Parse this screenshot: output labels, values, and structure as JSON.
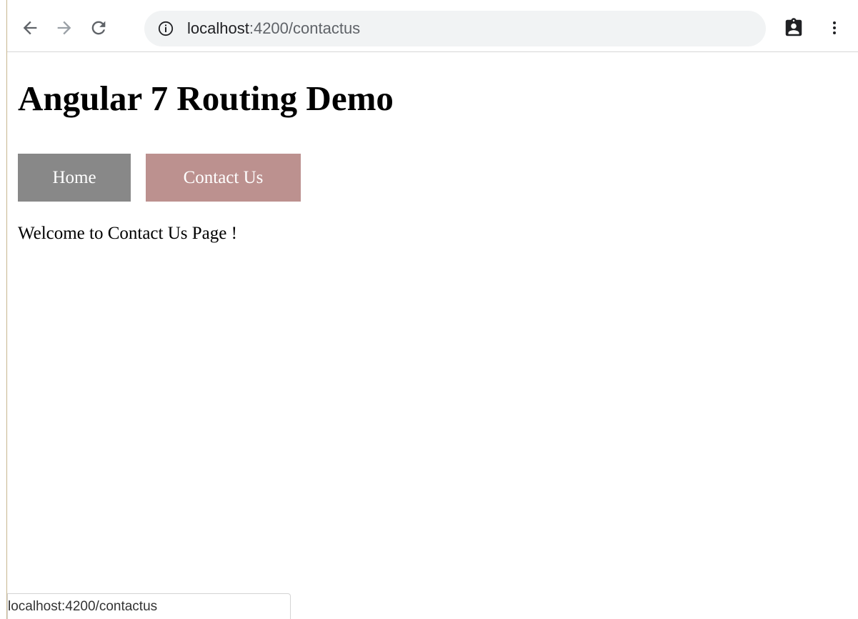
{
  "browser": {
    "url_host": "localhost",
    "url_rest": ":4200/contactus",
    "icons": {
      "back": "back-arrow-icon",
      "forward": "forward-arrow-icon",
      "reload": "reload-icon",
      "site_info": "info-icon",
      "clipboard": "clipboard-icon",
      "menu": "kebab-menu-icon"
    }
  },
  "page": {
    "title": "Angular 7 Routing Demo",
    "nav": [
      {
        "label": "Home",
        "color": "#888888"
      },
      {
        "label": "Contact Us",
        "color": "#bc918f"
      }
    ],
    "welcome": "Welcome to Contact Us Page !"
  },
  "status_bar": {
    "url": "localhost:4200/contactus"
  }
}
